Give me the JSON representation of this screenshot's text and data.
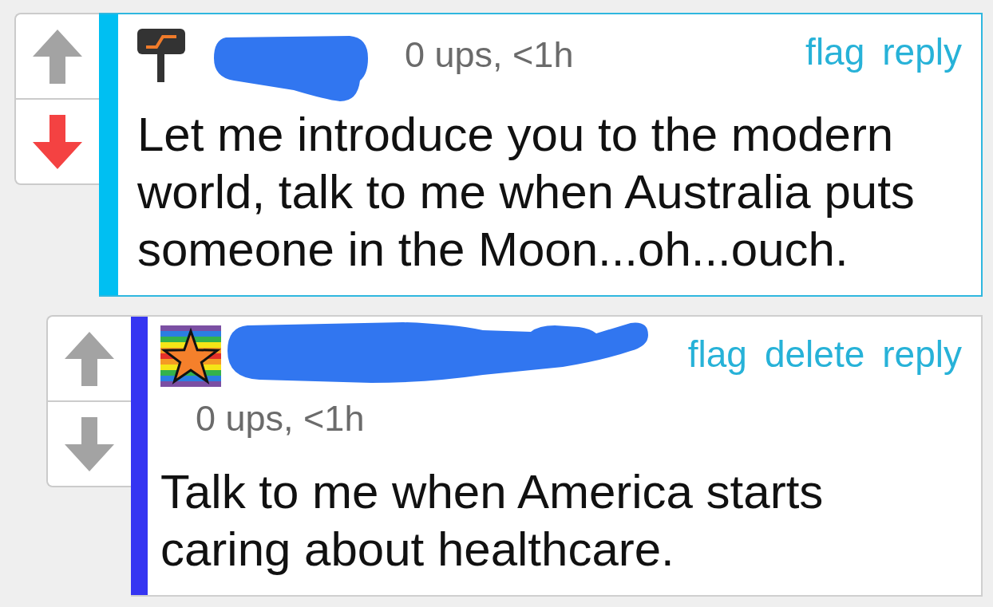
{
  "comments": [
    {
      "color": "#00bff2",
      "highlighted": true,
      "vote": {
        "upvoted": false,
        "downvoted": true
      },
      "meta": "0 ups, <1h",
      "actions": [
        "flag",
        "reply"
      ],
      "text": "Let me introduce you to the modern world, talk to me when Australia puts someone in the Moon...oh...ouch.",
      "children": [
        {
          "color": "#3535f2",
          "highlighted": false,
          "vote": {
            "upvoted": false,
            "downvoted": false
          },
          "meta": "0 ups, <1h",
          "actions": [
            "flag",
            "delete",
            "reply"
          ],
          "text": "Talk to me when America starts caring about healthcare."
        }
      ]
    }
  ]
}
